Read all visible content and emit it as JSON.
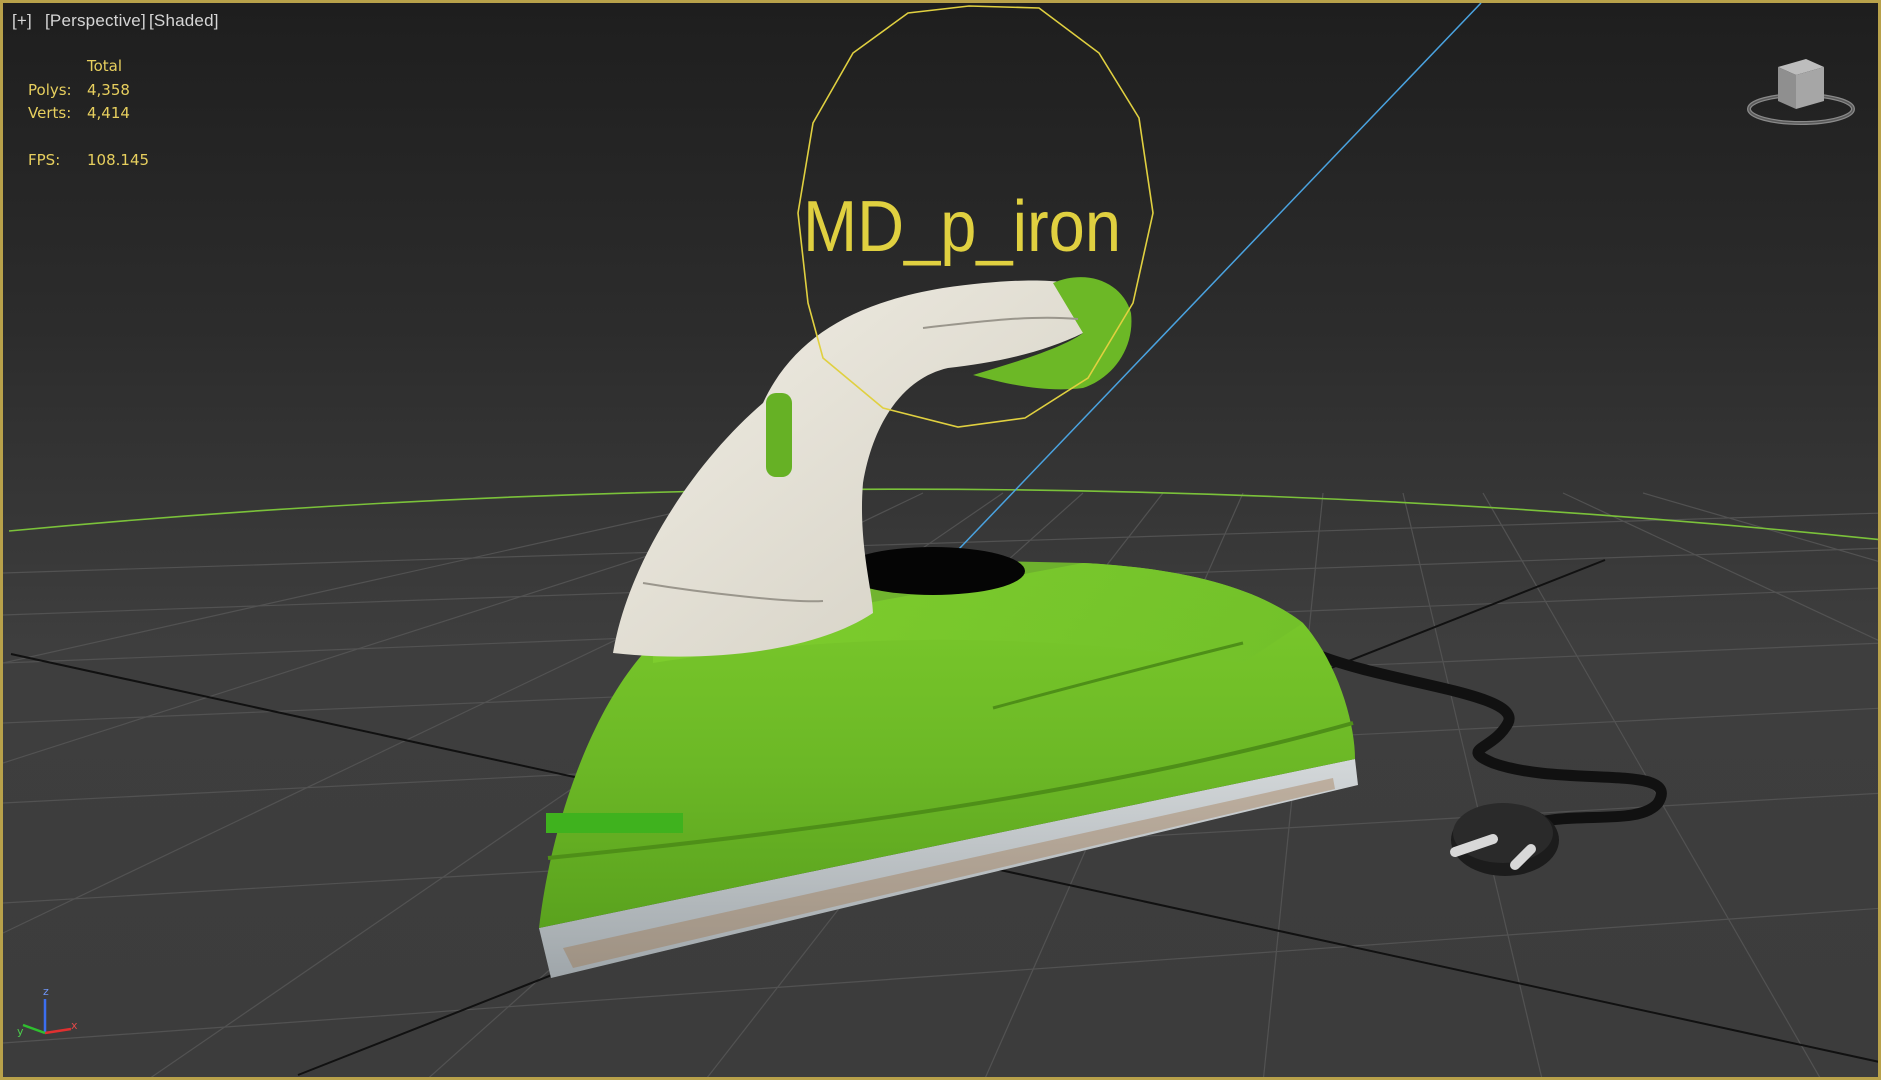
{
  "viewport": {
    "labels": [
      "[+]",
      "[Perspective]",
      "[Shaded]"
    ],
    "stats": {
      "header": "Total",
      "rows": [
        {
          "label": "Polys:",
          "value": "4,358"
        },
        {
          "label": "Verts:",
          "value": "4,414"
        }
      ],
      "fps_label": "FPS:",
      "fps_value": "108.145"
    },
    "object_name": "MD_p_iron",
    "viewcube_icon": "viewcube-icon",
    "axis_labels": {
      "x": "x",
      "y": "y",
      "z": "z"
    },
    "colors": {
      "border": "#b8a14a",
      "stats_text": "#e7cf5e",
      "helper_yellow": "#e0d040",
      "horizon_green": "#7bc23a",
      "camera_line": "#4aa3e0",
      "iron_green": "#6ab82a",
      "handle_white": "#e6e2d6",
      "soleplate": "#bfc4c8"
    }
  }
}
